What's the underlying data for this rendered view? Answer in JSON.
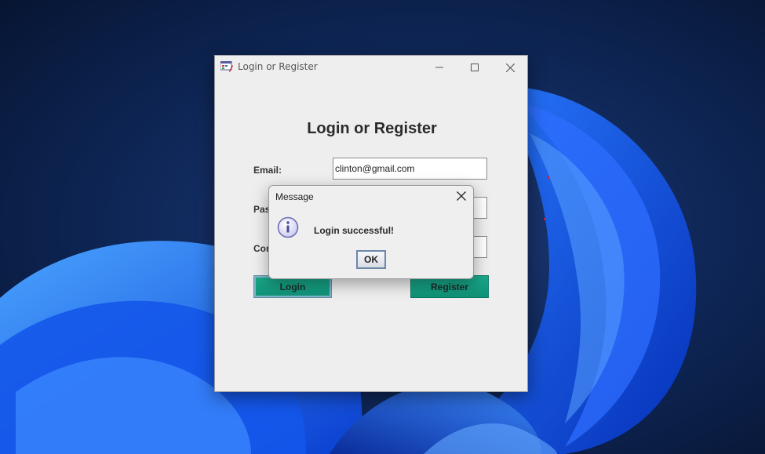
{
  "window": {
    "title": "Login or Register",
    "heading": "Login or Register",
    "labels": {
      "email": "Email:",
      "password": "Password:",
      "confirm": "Confirm Password:"
    },
    "fields": {
      "email": "clinton@gmail.com",
      "password": "",
      "confirm": ""
    },
    "buttons": {
      "login": "Login",
      "register": "Register"
    }
  },
  "dialog": {
    "title": "Message",
    "message": "Login successful!",
    "ok_label": "OK",
    "icon": "info-icon"
  },
  "colors": {
    "button_teal": "#119b7f",
    "window_bg": "#efeeee",
    "desktop_dark": "#0a1a3a",
    "desktop_bloom": "#1f5cf0"
  }
}
